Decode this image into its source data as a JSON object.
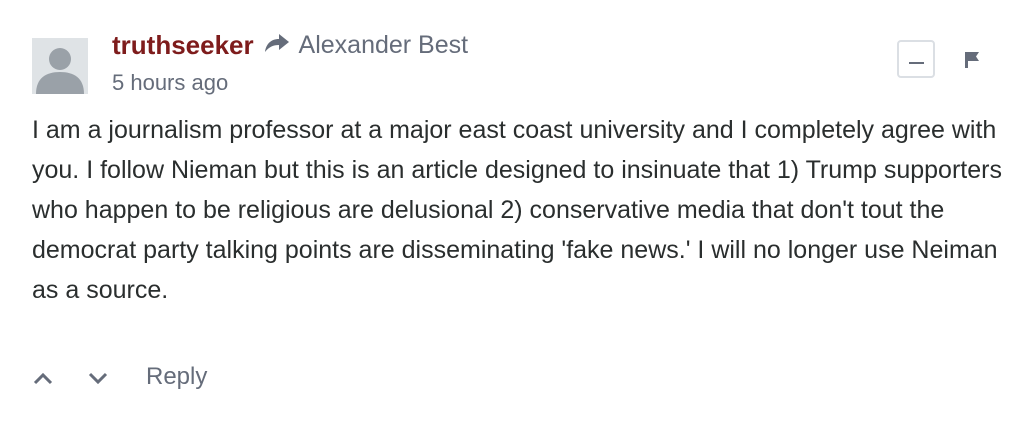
{
  "comment": {
    "author": "truthseeker",
    "reply_to": "Alexander Best",
    "timestamp": "5 hours ago",
    "text": "I am a journalism professor at a major east coast university and I completely agree with you. I follow Nieman but this is an article designed to insinuate that 1) Trump supporters who happen to be religious are delusional 2) conservative media that don't tout the democrat party talking points are disseminating 'fake news.' I will no longer use Neiman as a source."
  },
  "actions": {
    "reply_label": "Reply"
  },
  "icons": {
    "avatar": "default-avatar-icon",
    "reply_arrow": "share-arrow-icon",
    "collapse": "minus-icon",
    "flag": "flag-icon",
    "upvote": "chevron-up-icon",
    "downvote": "chevron-down-icon"
  },
  "colors": {
    "author": "#7e1c1c",
    "muted_text": "#656c7a",
    "body_text": "#2a2e2e",
    "avatar_bg": "#dfe3e6",
    "border": "#dbdfe4"
  }
}
